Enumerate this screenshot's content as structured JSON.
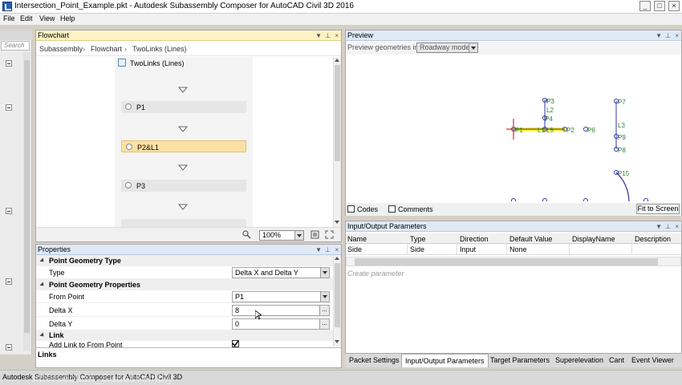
{
  "window": {
    "title": "Intersection_Point_Example.pkt - Autodesk Subassembly Composer for AutoCAD Civil 3D 2016",
    "min_glyph": "_",
    "max_glyph": "□",
    "close_glyph": "×"
  },
  "menu": [
    "File",
    "Edit",
    "View",
    "Help"
  ],
  "toolbox": {
    "search_placeholder": "Search"
  },
  "flowchart": {
    "title": "Flowchart",
    "breadcrumb": [
      "Subassembly",
      "Flowchart",
      "TwoLinks (Lines)"
    ],
    "breadcrumb_sep": "›",
    "sequence_title": "TwoLinks (Lines)",
    "nodes": [
      {
        "label": "P1",
        "selected": false
      },
      {
        "label": "P2&L1",
        "selected": true
      },
      {
        "label": "P3",
        "selected": false
      }
    ],
    "zoom": "100%"
  },
  "properties": {
    "title": "Properties",
    "categories": {
      "point_geometry_type": "Point Geometry Type",
      "point_geometry_properties": "Point Geometry Properties",
      "link": "Link"
    },
    "rows": {
      "type": {
        "label": "Type",
        "value": "Delta X and Delta Y"
      },
      "from_point": {
        "label": "From Point",
        "value": "P1"
      },
      "delta_x": {
        "label": "Delta X",
        "value": "8"
      },
      "delta_y": {
        "label": "Delta Y",
        "value": "0"
      },
      "add_link": {
        "label": "Add Link to From Point",
        "checked": true
      }
    },
    "ellipsis": "...",
    "footer": "Links"
  },
  "preview": {
    "title": "Preview",
    "geom_label": "Preview geometries in",
    "mode": "Roadway mode",
    "codes_label": "Codes",
    "comments_label": "Comments",
    "fit_button": "Fit to Screen",
    "labels": {
      "P1": "P1",
      "P2": "P2",
      "P3": "P3",
      "P4": "P4",
      "P6": "P6",
      "P7": "P7",
      "P8": "P8",
      "P9": "P9",
      "P15": "P15",
      "L1": "L1",
      "L2": "L2",
      "L3": "L3",
      "L5": "L5"
    }
  },
  "io_params": {
    "title": "Input/Output Parameters",
    "columns": [
      "Name",
      "Type",
      "Direction",
      "Default Value",
      "DisplayName",
      "Description"
    ],
    "rows": [
      [
        "Side",
        "Side",
        "Input",
        "None",
        "",
        ""
      ]
    ],
    "create_placeholder": "Create parameter"
  },
  "bottom_tabs": [
    "Packet Settings",
    "Input/Output Parameters",
    "Target Parameters",
    "Superelevation",
    "Cant",
    "Event Viewer"
  ],
  "active_tab_index": 1,
  "status": {
    "text": "Autodesk Subassembly Composer for AutoCAD Civil 3D",
    "watermark": "Intersection_Subassembly"
  },
  "colors": {
    "selected_node": "#fde1a2",
    "link_highlight": "#ffee00",
    "point_blue": "#3333aa",
    "point_label_green": "#2e7d32",
    "origin_red": "#d00000"
  }
}
